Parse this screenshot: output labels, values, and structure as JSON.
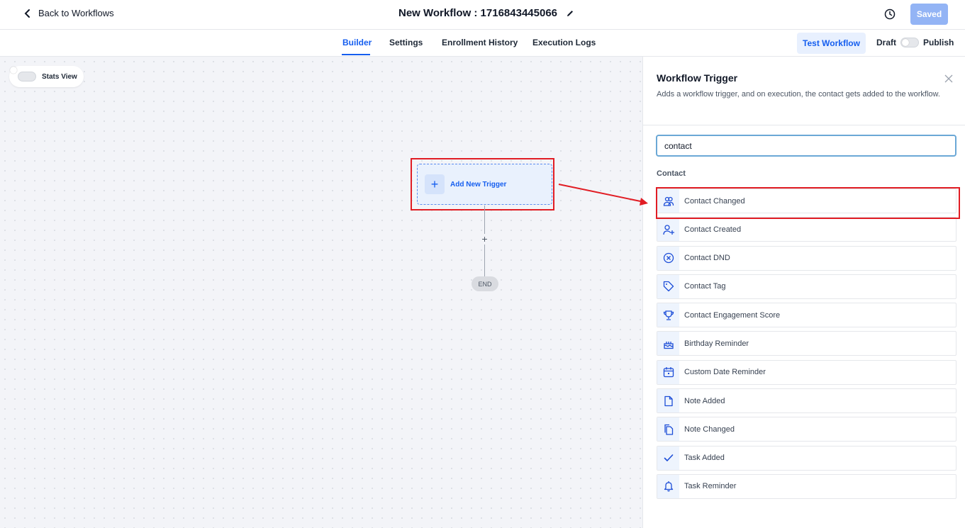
{
  "header": {
    "back_label": "Back to Workflows",
    "workflow_title": "New Workflow : 1716843445066",
    "saved_label": "Saved"
  },
  "tabs": [
    {
      "label": "Builder",
      "active": true
    },
    {
      "label": "Settings",
      "active": false
    },
    {
      "label": "Enrollment History",
      "active": false
    },
    {
      "label": "Execution Logs",
      "active": false
    }
  ],
  "actions": {
    "test_workflow_label": "Test Workflow",
    "draft_label": "Draft",
    "publish_label": "Publish"
  },
  "canvas": {
    "stats_view_label": "Stats View",
    "add_trigger_label": "Add New Trigger",
    "add_step_symbol": "+",
    "end_label": "END"
  },
  "panel": {
    "title": "Workflow Trigger",
    "description": "Adds a workflow trigger, and on execution, the contact gets added to the workflow.",
    "search_value": "contact",
    "group_title": "Contact",
    "items": [
      {
        "label": "Contact Changed",
        "icon": "users-icon"
      },
      {
        "label": "Contact Created",
        "icon": "user-plus-icon"
      },
      {
        "label": "Contact DND",
        "icon": "circle-x-icon"
      },
      {
        "label": "Contact Tag",
        "icon": "tag-icon"
      },
      {
        "label": "Contact Engagement Score",
        "icon": "trophy-icon"
      },
      {
        "label": "Birthday Reminder",
        "icon": "cake-icon"
      },
      {
        "label": "Custom Date Reminder",
        "icon": "calendar-icon"
      },
      {
        "label": "Note Added",
        "icon": "file-icon"
      },
      {
        "label": "Note Changed",
        "icon": "files-icon"
      },
      {
        "label": "Task Added",
        "icon": "check-icon"
      },
      {
        "label": "Task Reminder",
        "icon": "bell-icon"
      }
    ]
  },
  "colors": {
    "accent": "#155eef",
    "highlight": "#e11d24",
    "saved_button": "#93b4f5",
    "icon_bg": "#eef4fd"
  }
}
